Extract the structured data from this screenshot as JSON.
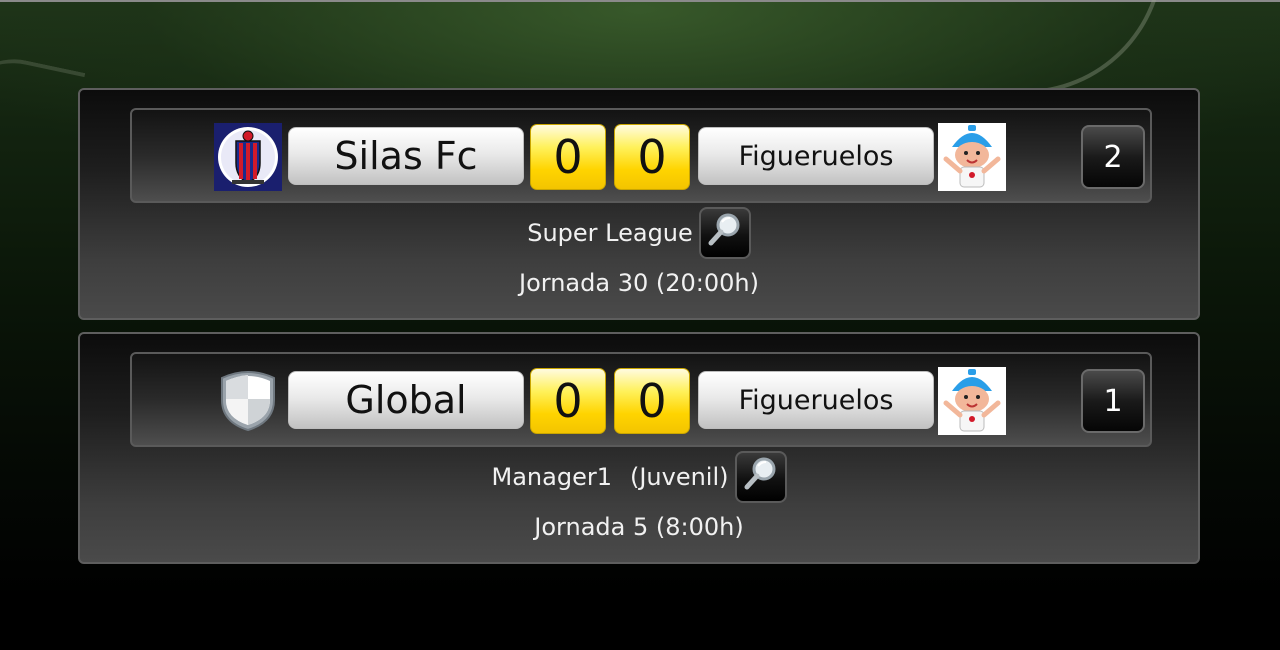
{
  "matches": [
    {
      "home_team": "Silas Fc",
      "home_crest": "striped-club-crest-icon",
      "home_score": "0",
      "away_score": "0",
      "away_team": "Figueruelos",
      "away_crest": "cartoon-kid-mascot-icon",
      "badge": "2",
      "league": "Super League",
      "round": "Jornada 30 (20:00h)"
    },
    {
      "home_team": "Global",
      "home_crest": "blank-shield-crest-icon",
      "home_score": "0",
      "away_score": "0",
      "away_team": "Figueruelos",
      "away_crest": "cartoon-kid-mascot-icon",
      "badge": "1",
      "league": "Manager1",
      "league_suffix": "(Juvenil)",
      "round": "Jornada 5 (8:00h)"
    }
  ],
  "colors": {
    "score_yellow": "#ffd400",
    "text_light": "#f1f1f1",
    "card_border": "#5e5e5e"
  },
  "icons": {
    "search": "magnifier-icon"
  }
}
